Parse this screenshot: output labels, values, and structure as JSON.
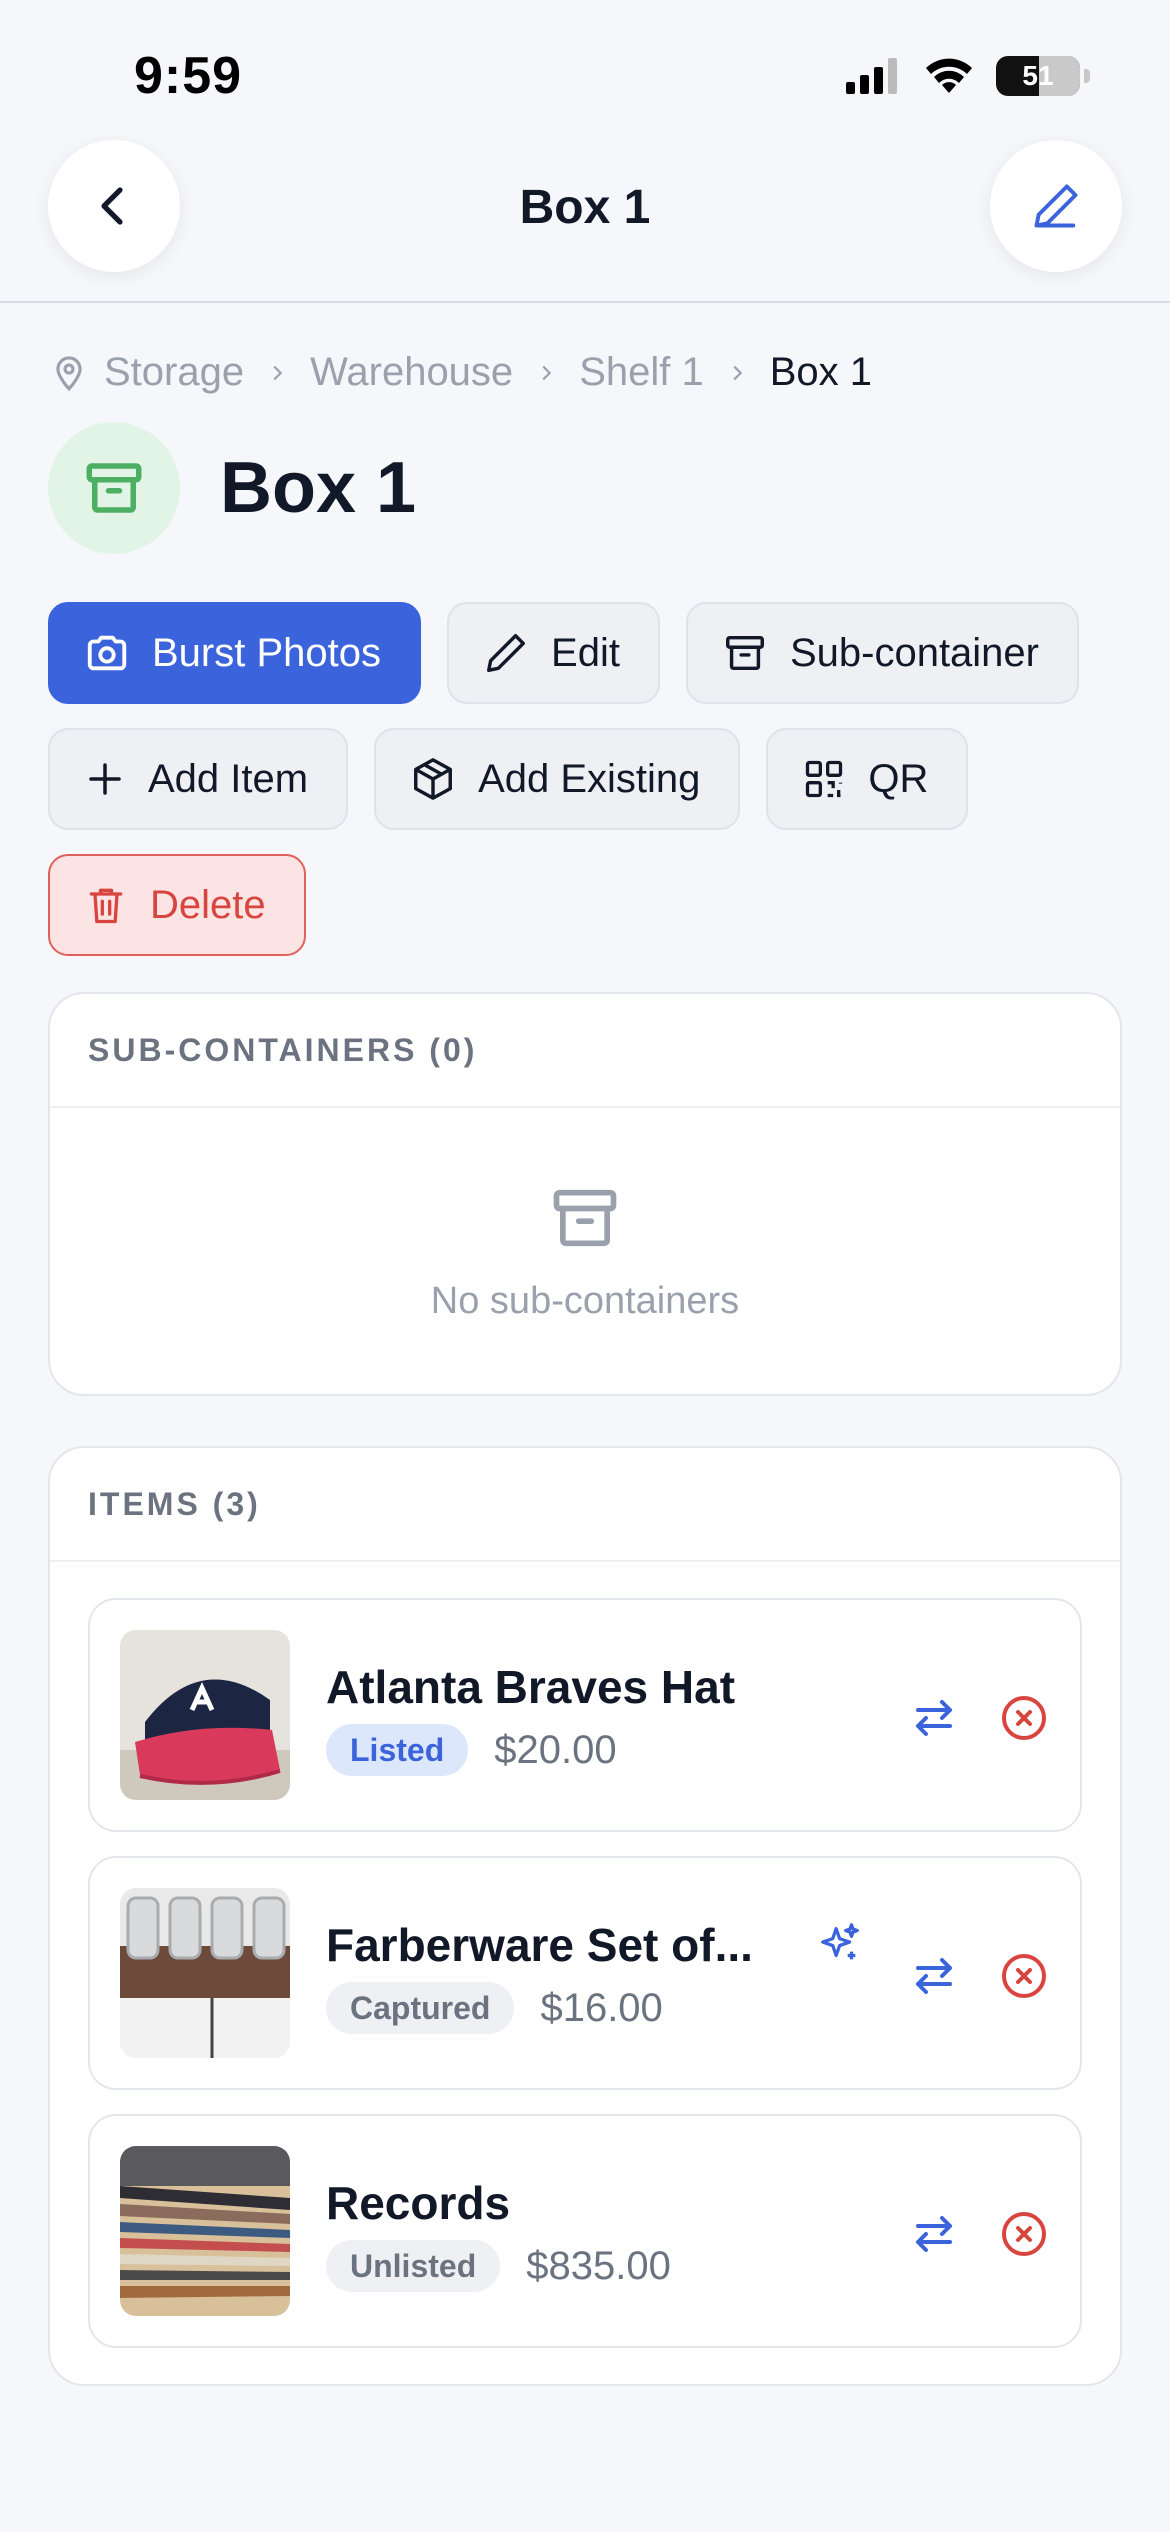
{
  "status_bar": {
    "time": "9:59",
    "battery": "51"
  },
  "header": {
    "title": "Box 1"
  },
  "breadcrumb": [
    "Storage",
    "Warehouse",
    "Shelf 1",
    "Box 1"
  ],
  "page": {
    "title": "Box 1"
  },
  "actions": {
    "burst_photos": "Burst Photos",
    "edit": "Edit",
    "sub_container": "Sub-container",
    "add_item": "Add Item",
    "add_existing": "Add Existing",
    "qr": "QR",
    "delete": "Delete"
  },
  "sub_containers": {
    "header": "SUB-CONTAINERS (0)",
    "empty_text": "No sub-containers"
  },
  "items": {
    "header": "ITEMS (3)",
    "list": [
      {
        "name": "Atlanta Braves Hat",
        "status": "Listed",
        "price": "$20.00"
      },
      {
        "name": "Farberware Set of...",
        "status": "Captured",
        "price": "$16.00"
      },
      {
        "name": "Records",
        "status": "Unlisted",
        "price": "$835.00"
      }
    ]
  },
  "colors": {
    "primary": "#3b63dc",
    "danger": "#d8453f",
    "success": "#4caf62"
  }
}
